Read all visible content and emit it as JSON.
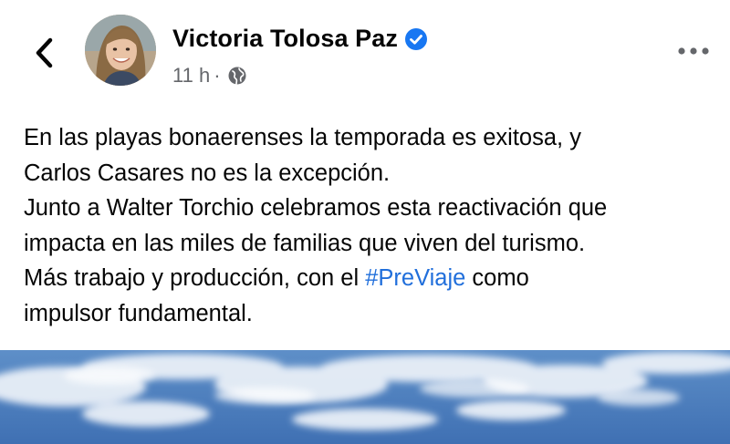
{
  "post": {
    "author": "Victoria Tolosa Paz",
    "time": "11 h",
    "separator": "·",
    "privacy_icon": "globe-icon",
    "verified_icon": "verified-badge-icon",
    "verified_color": "#1877f2",
    "hashtag_color": "#216fdb",
    "text": {
      "line1": "En las playas bonaerenses la temporada es exitosa, y",
      "line2": "Carlos Casares no es la excepción.",
      "line3": "Junto a Walter Torchio celebramos esta reactivación que",
      "line4": "impacta en las miles de familias que viven del turismo.",
      "line5_before": "Más trabajo y producción, con el ",
      "line5_hashtag": "#PreViaje",
      "line5_after": " como",
      "line6": "impulsor fundamental."
    }
  },
  "header": {
    "back_icon": "chevron-left-icon",
    "more_icon": "more-horizontal-icon"
  }
}
